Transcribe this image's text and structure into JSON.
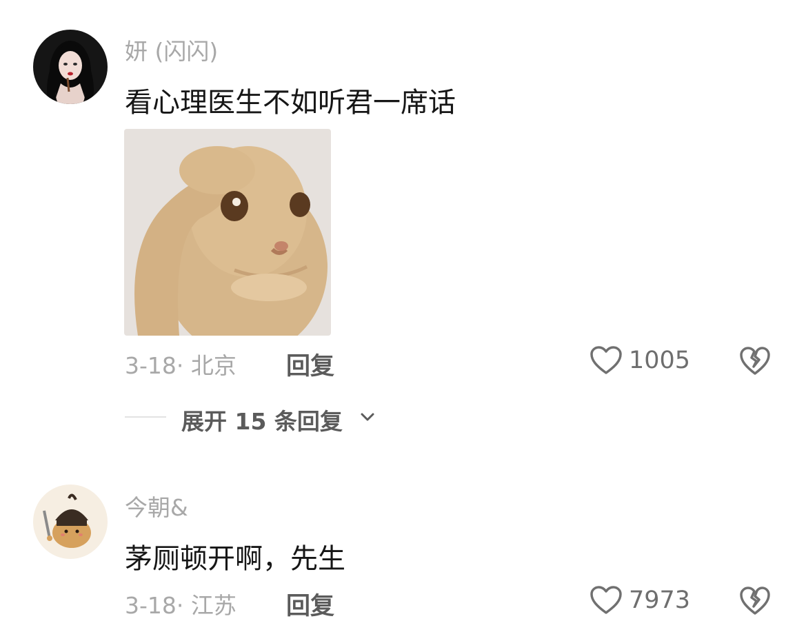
{
  "comments": [
    {
      "username": "妍 (闪闪)",
      "text": "看心理医生不如听君一席话",
      "meta": "3-18· 北京",
      "reply_label": "回复",
      "likes": "1005",
      "expand_label": "展开 15 条回复"
    },
    {
      "username": "今朝&",
      "text": "茅厕顿开啊，先生",
      "meta": "3-18· 江苏",
      "reply_label": "回复",
      "likes": "7973"
    }
  ],
  "icons": {
    "like": "heart-outline-icon",
    "dislike": "broken-heart-icon",
    "expand": "chevron-down-icon"
  },
  "colors": {
    "username": "#a8a8a8",
    "text": "#161616",
    "reply": "#5b5b5b",
    "count": "#6e6e6e"
  }
}
